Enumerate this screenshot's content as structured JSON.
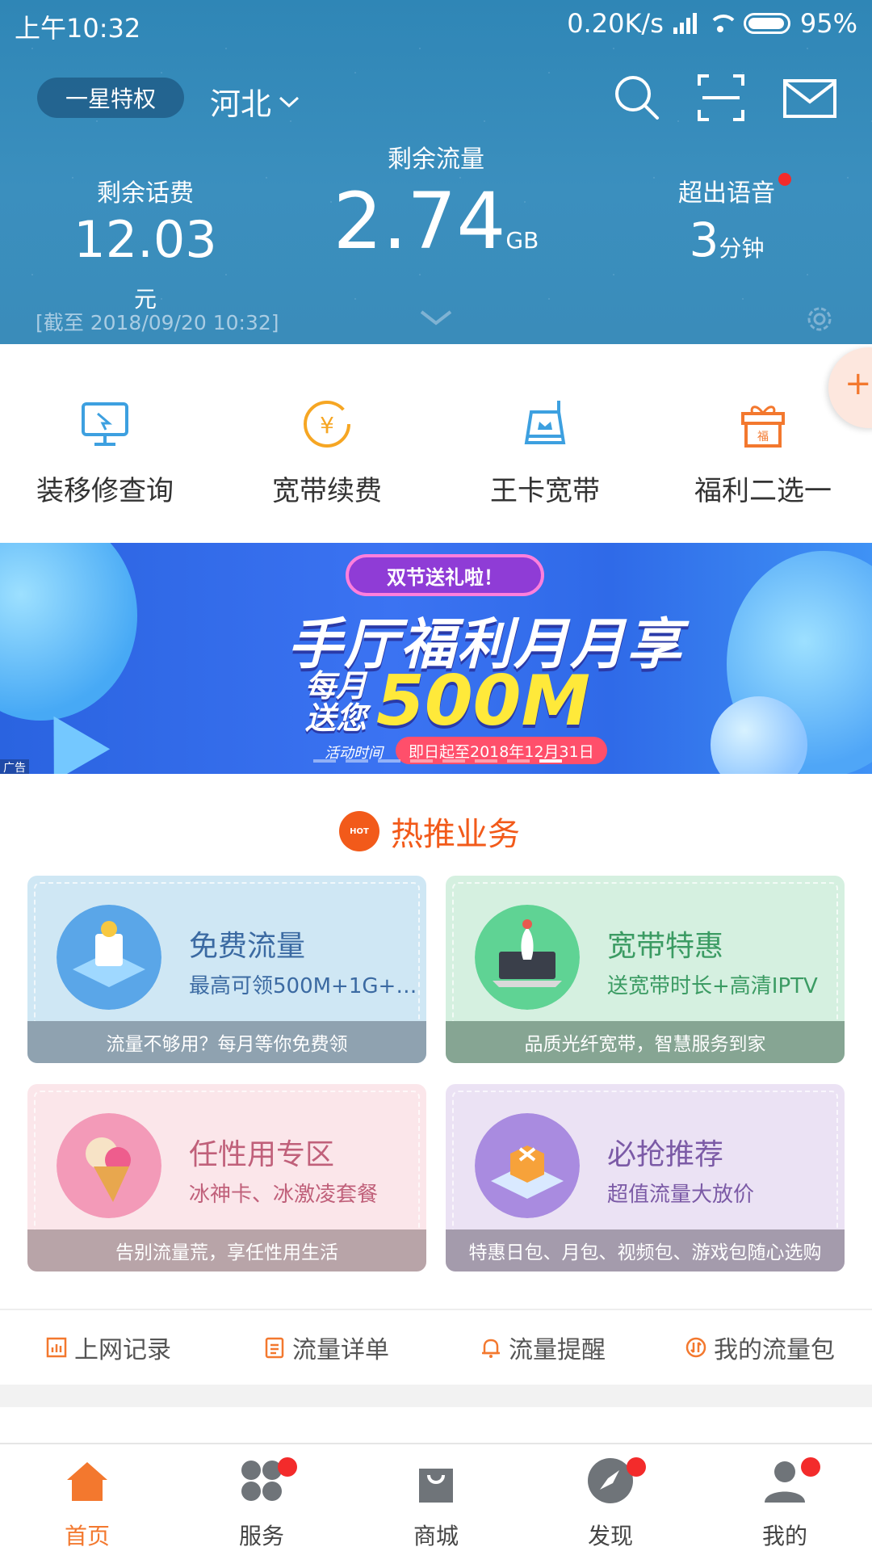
{
  "status_bar": {
    "time": "上午10:32",
    "network_speed": "0.20K/s",
    "battery": "95%"
  },
  "header": {
    "vip_level": "一星特权",
    "region": "河北",
    "balance": {
      "label": "剩余话费",
      "value": "12.03",
      "unit": "元"
    },
    "data": {
      "label": "剩余流量",
      "value": "2.74",
      "unit": "GB"
    },
    "voice": {
      "label": "超出语音",
      "value": "3",
      "unit": "分钟"
    },
    "as_of": "[截至 2018/09/20 10:32]"
  },
  "quick_actions": [
    {
      "label": "装移修查询",
      "icon": "monitor-icon"
    },
    {
      "label": "宽带续费",
      "icon": "yen-coin-icon"
    },
    {
      "label": "王卡宽带",
      "icon": "router-icon"
    },
    {
      "label": "福利二选一",
      "icon": "gift-icon"
    }
  ],
  "banner": {
    "pill": "双节送礼啦！",
    "title": "手厅福利月月享",
    "line1": "每月",
    "line2": "送您",
    "big": "500M",
    "activity_label": "活动时间",
    "date_range": "即日起至2018年12月31日",
    "ad_tag": "广告"
  },
  "hot": {
    "title": "热推业务",
    "badge": "HOT",
    "cards": [
      {
        "title": "免费流量",
        "subtitle": "最高可领500M+1G+…",
        "footer": "流量不够用？每月等你免费领"
      },
      {
        "title": "宽带特惠",
        "subtitle": "送宽带时长+高清IPTV",
        "footer": "品质光纤宽带，智慧服务到家"
      },
      {
        "title": "任性用专区",
        "subtitle": "冰神卡、冰激凌套餐",
        "footer": "告别流量荒，享任性用生活"
      },
      {
        "title": "必抢推荐",
        "subtitle": "超值流量大放价",
        "footer": "特惠日包、月包、视频包、游戏包随心选购"
      }
    ]
  },
  "links": [
    {
      "label": "上网记录"
    },
    {
      "label": "流量详单"
    },
    {
      "label": "流量提醒"
    },
    {
      "label": "我的流量包"
    }
  ],
  "bottom_nav": [
    {
      "label": "首页",
      "active": true
    },
    {
      "label": "服务"
    },
    {
      "label": "商城"
    },
    {
      "label": "发现"
    },
    {
      "label": "我的"
    }
  ],
  "colors": {
    "header_blue": "#3a8cba",
    "accent_orange": "#f3782e",
    "badge_red": "#f32b2b"
  }
}
